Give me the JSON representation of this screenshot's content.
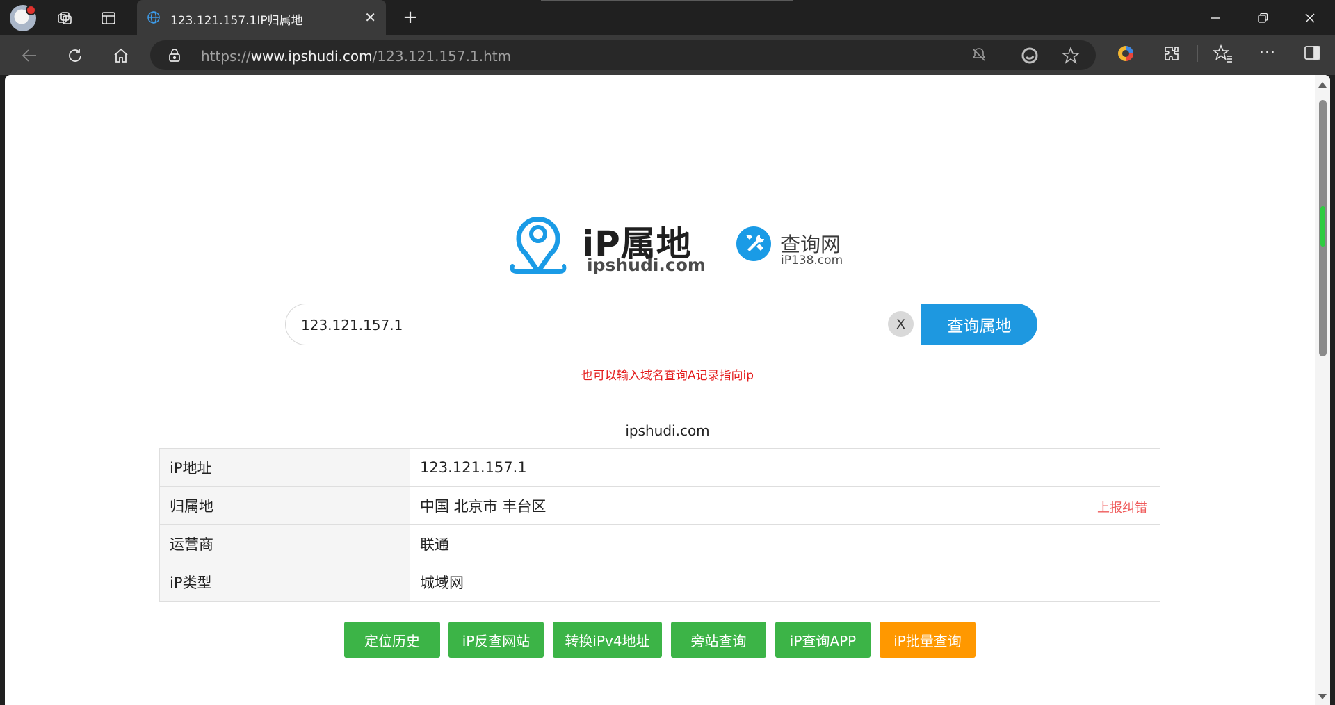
{
  "browser": {
    "tab_title": "123.121.157.1IP归属地",
    "url_prefix": "https://",
    "url_domain": "www.ipshudi.com",
    "url_path": "/123.121.157.1.htm"
  },
  "logos": {
    "primary_title": "iP属地",
    "primary_sub": "ipshudi.com",
    "secondary_title": "查询网",
    "secondary_sub": "iP138.com"
  },
  "search": {
    "value": "123.121.157.1",
    "clear_label": "X",
    "submit_label": "查询属地",
    "hint": "也可以输入域名查询A记录指向ip"
  },
  "result": {
    "site": "ipshudi.com",
    "rows": [
      {
        "label": "iP地址",
        "value": "123.121.157.1"
      },
      {
        "label": "归属地",
        "value": "中国 北京市 丰台区"
      },
      {
        "label": "运营商",
        "value": "联通"
      },
      {
        "label": "iP类型",
        "value": "城域网"
      }
    ],
    "report_label": "上报纠错"
  },
  "actions": [
    {
      "label": "定位历史"
    },
    {
      "label": "iP反查网站"
    },
    {
      "label": "转换iPv4地址"
    },
    {
      "label": "旁站查询"
    },
    {
      "label": "iP查询APP"
    },
    {
      "label": "iP批量查询"
    }
  ],
  "colors": {
    "accent_blue": "#1e98e0",
    "button_green": "#3cb447",
    "button_orange": "#ff9800",
    "hint_red": "#e41b1b"
  }
}
